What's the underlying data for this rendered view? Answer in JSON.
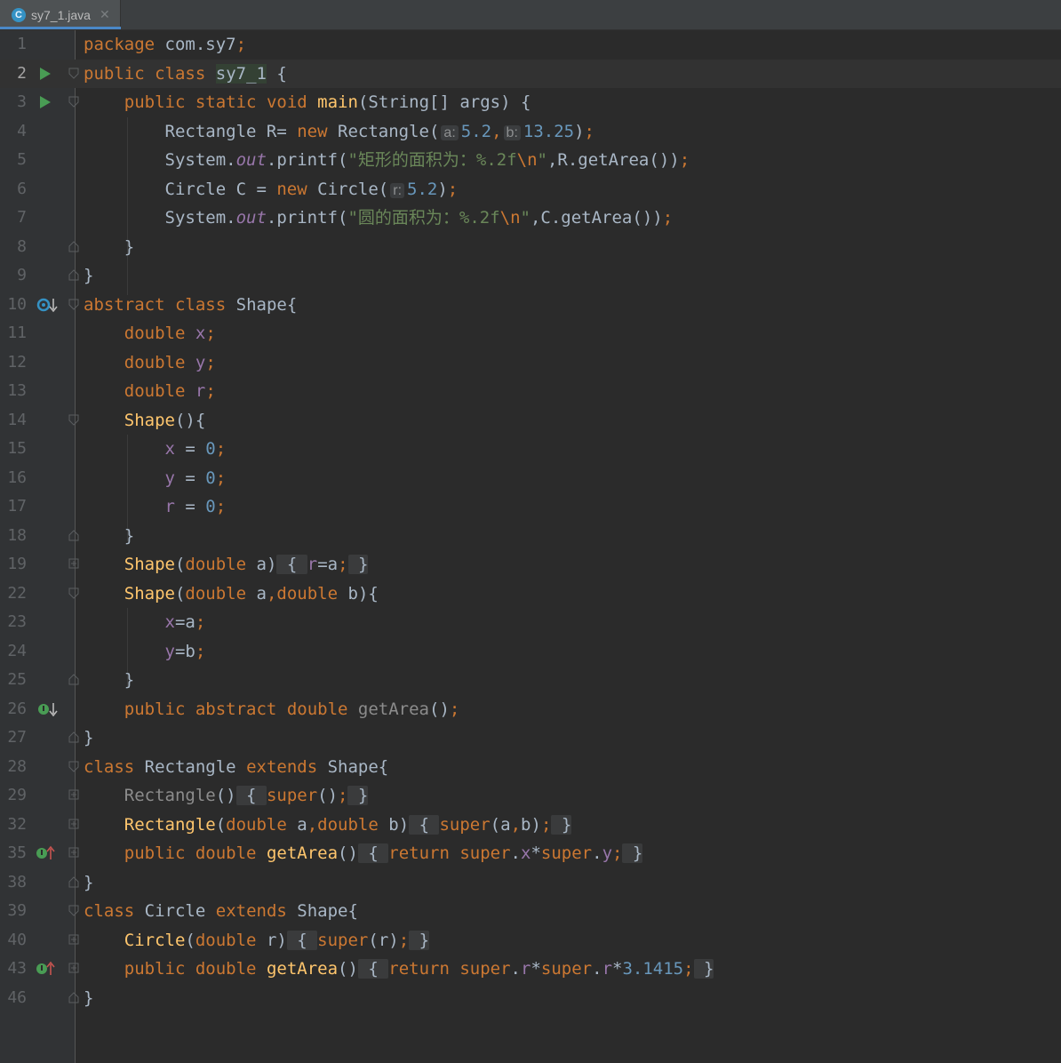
{
  "tab": {
    "icon_letter": "C",
    "file_name": "sy7_1.java",
    "close": "✕"
  },
  "colors": {
    "background": "#2b2b2b",
    "gutter": "#313335",
    "keyword": "#cc7832",
    "function": "#ffc66d",
    "number": "#6897bb",
    "string": "#6a8759",
    "field": "#9876aa",
    "run_icon": "#499c54"
  },
  "gutter_icons": {
    "line_2": "run-icon",
    "line_3": "run-icon",
    "line_10": "implemented-down-icon",
    "line_26": "implemented-down-icon",
    "line_35": "implements-up-icon",
    "line_43": "implements-up-icon"
  },
  "lines": [
    {
      "n": "1",
      "t": "package com.sy7;"
    },
    {
      "n": "2",
      "t": "public class sy7_1 {"
    },
    {
      "n": "3",
      "t": "    public static void main(String[] args) {"
    },
    {
      "n": "4",
      "t": "        Rectangle R= new Rectangle( a: 5.2, b: 13.25);"
    },
    {
      "n": "5",
      "t": "        System.out.printf(\"矩形的面积为：%.2f\\n\",R.getArea());"
    },
    {
      "n": "6",
      "t": "        Circle C = new Circle( r: 5.2);"
    },
    {
      "n": "7",
      "t": "        System.out.printf(\"圆的面积为：%.2f\\n\",C.getArea());"
    },
    {
      "n": "8",
      "t": "    }"
    },
    {
      "n": "9",
      "t": "}"
    },
    {
      "n": "10",
      "t": "abstract class Shape{"
    },
    {
      "n": "11",
      "t": "    double x;"
    },
    {
      "n": "12",
      "t": "    double y;"
    },
    {
      "n": "13",
      "t": "    double r;"
    },
    {
      "n": "14",
      "t": "    Shape(){"
    },
    {
      "n": "15",
      "t": "        x = 0;"
    },
    {
      "n": "16",
      "t": "        y = 0;"
    },
    {
      "n": "17",
      "t": "        r = 0;"
    },
    {
      "n": "18",
      "t": "    }"
    },
    {
      "n": "19",
      "t": "    Shape(double a) { r=a; }"
    },
    {
      "n": "22",
      "t": "    Shape(double a,double b){"
    },
    {
      "n": "23",
      "t": "        x=a;"
    },
    {
      "n": "24",
      "t": "        y=b;"
    },
    {
      "n": "25",
      "t": "    }"
    },
    {
      "n": "26",
      "t": "    public abstract double getArea();"
    },
    {
      "n": "27",
      "t": "}"
    },
    {
      "n": "28",
      "t": "class Rectangle extends Shape{"
    },
    {
      "n": "29",
      "t": "    Rectangle() { super(); }"
    },
    {
      "n": "32",
      "t": "    Rectangle(double a,double b) { super(a,b); }"
    },
    {
      "n": "35",
      "t": "    public double getArea() { return super.x*super.y; }"
    },
    {
      "n": "38",
      "t": "}"
    },
    {
      "n": "39",
      "t": "class Circle extends Shape{"
    },
    {
      "n": "40",
      "t": "    Circle(double r) { super(r); }"
    },
    {
      "n": "43",
      "t": "    public double getArea() { return super.r*super.r*3.1415; }"
    },
    {
      "n": "46",
      "t": "}"
    }
  ],
  "tokens": {
    "package": "package",
    "public": "public",
    "class": "class",
    "static": "static",
    "void": "void",
    "new": "new",
    "abstract": "abstract",
    "double": "double",
    "extends": "extends",
    "super": "super",
    "return": "return",
    "pkg": " com.sy7",
    "semi": ";",
    "sy7_1": "sy7_1",
    "main": "main",
    "main_args": "(String[] args) {",
    "rect_decl": "Rectangle R= ",
    "rectangle": "Rectangle",
    "paren_open": "(",
    "paren_close": ")",
    "hint_a": "a:",
    "hint_b": "b:",
    "hint_r": "r:",
    "num_5_2": "5.2",
    "num_13_25": "13.25",
    "num_0": "0",
    "num_3_1415": "3.1415",
    "comma": ",",
    "system": "System.",
    "out": "out",
    "printf": ".printf(",
    "str_rect": "\"矩形的面积为：%.2f",
    "escape_n": "\\n",
    "quote": "\"",
    "rect_call": ",R.getArea())",
    "circle_decl": "Circle C = ",
    "circle": "Circle",
    "str_circle": "\"圆的面积为：%.2f",
    "circle_call": ",C.getArea())",
    "close_brace": "}",
    "open_brace": "{",
    "shape": "Shape",
    "shape_brace": "Shape{",
    "space": " ",
    "fld_x": "x",
    "fld_y": "y",
    "fld_r": "r",
    "eq_spaced": " = ",
    "eq": "=",
    "empty_parens": "()",
    "empty_parens_brace": "(){",
    "param_a": " a",
    "param_b": " b",
    "param_r": " r",
    "var_a": "a",
    "var_b": "b",
    "var_r": "r",
    "fold_open": " { ",
    "fold_close": " }",
    "brace_open_line": "){",
    "getArea": "getArea",
    "dot": ".",
    "star": "*",
    "abstract_paren": "()"
  }
}
